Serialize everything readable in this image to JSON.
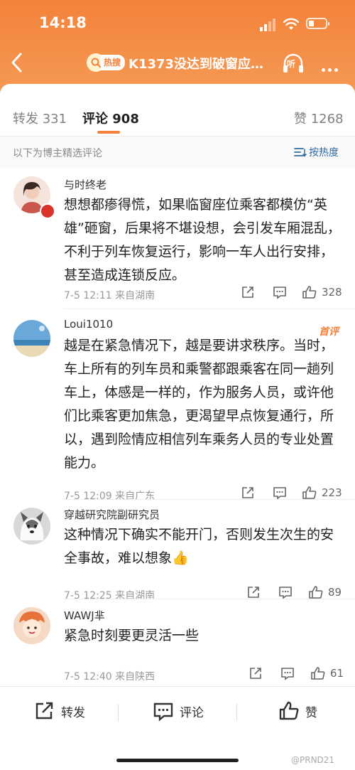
{
  "status": {
    "time": "14:18"
  },
  "nav": {
    "hot_tag": "热搜",
    "title": "K1373没达到破窗应…",
    "listen": "听"
  },
  "tabs": {
    "repost": "转发 331",
    "comment": "评论 908",
    "like": "赞 1268"
  },
  "selection": {
    "note": "以下为博主精选评论",
    "sort": "按热度"
  },
  "comments": [
    {
      "user": "与时终老",
      "text": "想想都瘆得慌，如果临窗座位乘客都模仿“英雄”砸窗，后果将不堪设想，会引发车厢混乱，不利于列车恢复运行，影响一车人出行安排，甚至造成连锁反应。",
      "meta": "7-5 12:11  来自湖南",
      "likes": "328"
    },
    {
      "user": "Loui1010",
      "badge": "首评",
      "text": "越是在紧急情况下，越是要讲求秩序。当时，车上所有的列车员和乘警都跟乘客在同一趟列车上，体感是一样的，作为服务人员，或许他们比乘客更加焦急，更渴望早点恢复通行，所以，遇到险情应相信列车乘务人员的专业处置能力。",
      "meta": "7-5 12:09  来自广东",
      "likes": "223"
    },
    {
      "user": "穿越研究院副研究员",
      "text": "这种情况下确实不能开门，否则发生次生的安全事故，难以想象👍",
      "meta": "7-5 12:25  来自湖南",
      "likes": "89"
    },
    {
      "user": "WAWJ芈",
      "text": "紧急时刻要更灵活一些",
      "meta": "7-5 12:40  来自陕西",
      "likes": "61"
    }
  ],
  "bottom": {
    "repost": "转发",
    "comment": "评论",
    "like": "赞",
    "watermark": "@PRND21"
  },
  "colors": {
    "accent": "#f3823a",
    "link": "#2f6aa3"
  }
}
